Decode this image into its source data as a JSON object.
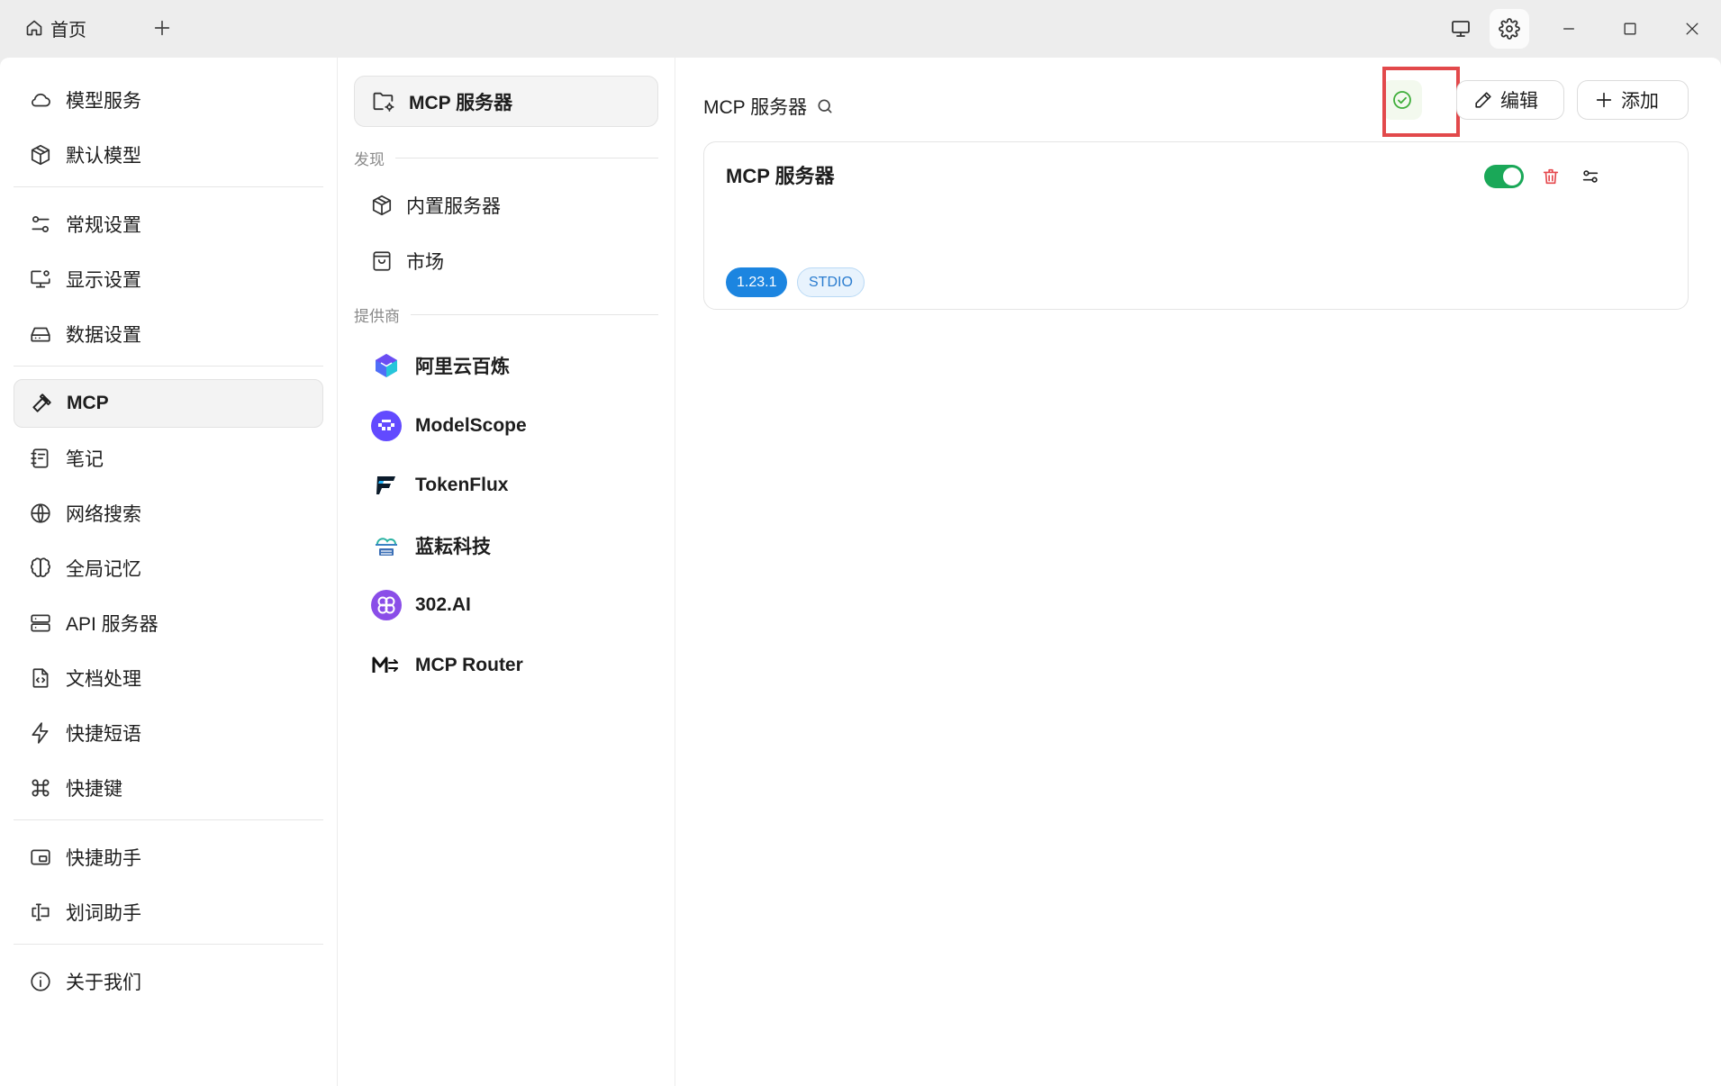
{
  "titlebar": {
    "home_tab_label": "首页",
    "icons": [
      "home-icon",
      "plus-icon",
      "monitor-icon",
      "gear-icon",
      "minimize-icon",
      "maximize-icon",
      "close-icon"
    ]
  },
  "sidebar": {
    "groups": [
      [
        {
          "label": "模型服务",
          "icon": "cloud-icon"
        },
        {
          "label": "默认模型",
          "icon": "cube-icon"
        }
      ],
      [
        {
          "label": "常规设置",
          "icon": "sliders-icon"
        },
        {
          "label": "显示设置",
          "icon": "display-settings-icon"
        },
        {
          "label": "数据设置",
          "icon": "hard-drive-icon"
        }
      ],
      [
        {
          "label": "MCP",
          "icon": "hammer-icon",
          "active": true
        },
        {
          "label": "笔记",
          "icon": "notebook-icon"
        },
        {
          "label": "网络搜索",
          "icon": "globe-icon"
        },
        {
          "label": "全局记忆",
          "icon": "brain-icon"
        },
        {
          "label": "API 服务器",
          "icon": "server-icon"
        },
        {
          "label": "文档处理",
          "icon": "file-code-icon"
        },
        {
          "label": "快捷短语",
          "icon": "zap-icon"
        },
        {
          "label": "快捷键",
          "icon": "command-icon"
        }
      ],
      [
        {
          "label": "快捷助手",
          "icon": "quick-assistant-icon"
        },
        {
          "label": "划词助手",
          "icon": "text-select-icon"
        }
      ],
      [
        {
          "label": "关于我们",
          "icon": "info-icon"
        }
      ]
    ]
  },
  "midnav": {
    "active_label": "MCP 服务器",
    "discover_label": "发现",
    "discover_items": [
      {
        "label": "内置服务器",
        "icon": "cube-icon"
      },
      {
        "label": "市场",
        "icon": "shopping-bag-icon"
      }
    ],
    "providers_label": "提供商",
    "providers": [
      {
        "label": "阿里云百炼",
        "icon": "aliyun-bailian-logo"
      },
      {
        "label": "ModelScope",
        "icon": "modelscope-logo"
      },
      {
        "label": "TokenFlux",
        "icon": "tokenflux-logo"
      },
      {
        "label": "蓝耘科技",
        "icon": "lanyun-logo"
      },
      {
        "label": "302.AI",
        "icon": "302ai-logo"
      },
      {
        "label": "MCP Router",
        "icon": "mcp-router-logo"
      }
    ]
  },
  "main": {
    "title": "MCP 服务器",
    "edit_label": "编辑",
    "add_label": "添加",
    "status": "ok",
    "server": {
      "name": "MCP 服务器",
      "enabled": true,
      "version": "1.23.1",
      "type": "STDIO"
    }
  },
  "colors": {
    "accent_green": "#1aa858",
    "tag_blue": "#1c85e0",
    "delete_red": "#e5484d",
    "highlight_red": "#e2494b"
  }
}
